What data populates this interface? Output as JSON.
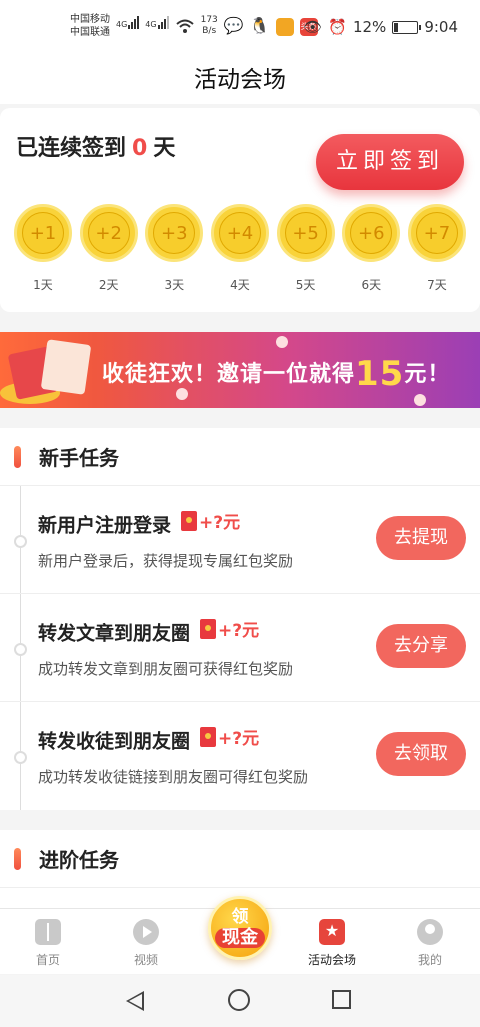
{
  "status": {
    "carrier1": "中国移动",
    "carrier2": "中国联通",
    "net1": "4G",
    "net2": "4G",
    "speed_value": "173",
    "speed_unit": "B/s",
    "battery": "12%",
    "time": "9:04",
    "app_badge": "头条",
    "brand_color": "#f04d4a"
  },
  "header": {
    "title": "活动会场"
  },
  "sign": {
    "prefix": "已连续签到",
    "days": "0",
    "suffix": "天",
    "button": "立即签到",
    "coins": [
      {
        "reward": "+1",
        "day": "1天"
      },
      {
        "reward": "+2",
        "day": "2天"
      },
      {
        "reward": "+3",
        "day": "3天"
      },
      {
        "reward": "+4",
        "day": "4天"
      },
      {
        "reward": "+5",
        "day": "5天"
      },
      {
        "reward": "+6",
        "day": "6天"
      },
      {
        "reward": "+7",
        "day": "7天"
      }
    ]
  },
  "banner": {
    "text_a": "收徒狂欢！邀请一位就得",
    "amount": "15",
    "text_b": "元！"
  },
  "newbie": {
    "title": "新手任务",
    "tasks": [
      {
        "name": "新用户注册登录",
        "reward": "+?元",
        "desc": "新用户登录后，获得提现专属红包奖励",
        "button": "去提现"
      },
      {
        "name": "转发文章到朋友圈",
        "reward": "+?元",
        "desc": "成功转发文章到朋友圈可获得红包奖励",
        "button": "去分享"
      },
      {
        "name": "转发收徒到朋友圈",
        "reward": "+?元",
        "desc": "成功转发收徒链接到朋友圈可得红包奖励",
        "button": "去领取"
      }
    ]
  },
  "advanced": {
    "title": "进阶任务"
  },
  "tabbar": {
    "home": "首页",
    "video": "视频",
    "cash_line1": "领",
    "cash_line2": "现金",
    "activity": "活动会场",
    "mine": "我的"
  }
}
